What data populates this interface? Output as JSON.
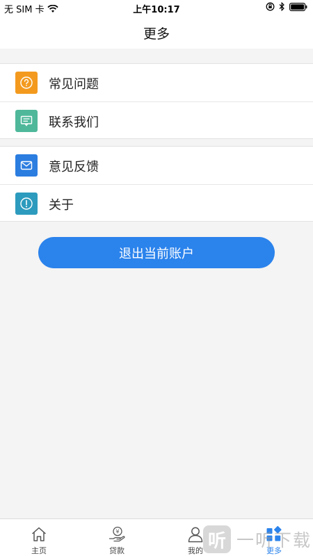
{
  "status_bar": {
    "carrier": "无 SIM 卡",
    "time": "上午10:17"
  },
  "nav": {
    "title": "更多"
  },
  "menu": {
    "group1": [
      {
        "label": "常见问题",
        "icon": "question-icon",
        "color": "#f39a1e"
      },
      {
        "label": "联系我们",
        "icon": "message-icon",
        "color": "#4fb89a"
      }
    ],
    "group2": [
      {
        "label": "意见反馈",
        "icon": "mail-icon",
        "color": "#2b7de0"
      },
      {
        "label": "关于",
        "icon": "info-icon",
        "color": "#2d9bbd"
      }
    ]
  },
  "logout": {
    "label": "退出当前账户",
    "color": "#2b83ec"
  },
  "tab_bar": {
    "tabs": [
      {
        "label": "主页",
        "icon": "home-icon"
      },
      {
        "label": "贷款",
        "icon": "loan-icon"
      },
      {
        "label": "我的",
        "icon": "user-icon"
      },
      {
        "label": "更多",
        "icon": "more-grid-icon",
        "active": true
      }
    ]
  },
  "watermark": {
    "glyph": "听",
    "text": "一听下载"
  }
}
